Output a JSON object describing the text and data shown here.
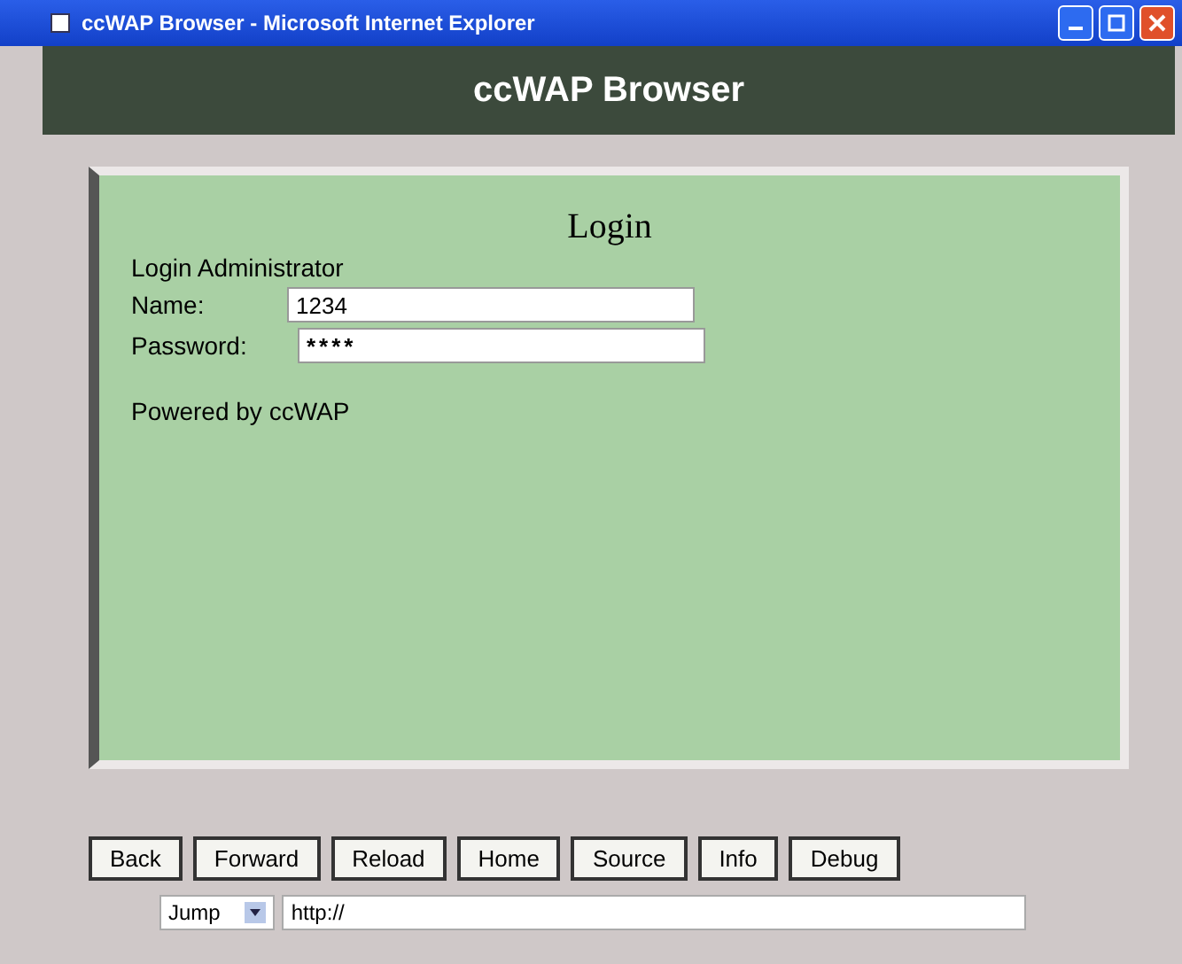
{
  "window": {
    "title": "ccWAP Browser - Microsoft Internet Explorer"
  },
  "header": {
    "title": "ccWAP Browser"
  },
  "screen": {
    "heading": "Login",
    "subtitle": "Login Administrator",
    "fields": [
      {
        "label": "Name:",
        "value": "1234",
        "kind": "text"
      },
      {
        "label": "Password:",
        "value": "****",
        "kind": "password"
      }
    ],
    "footer": "Powered by ccWAP"
  },
  "buttons": [
    "Back",
    "Forward",
    "Reload",
    "Home",
    "Source",
    "Info",
    "Debug"
  ],
  "address": {
    "mode": "Jump",
    "value": "http://"
  }
}
